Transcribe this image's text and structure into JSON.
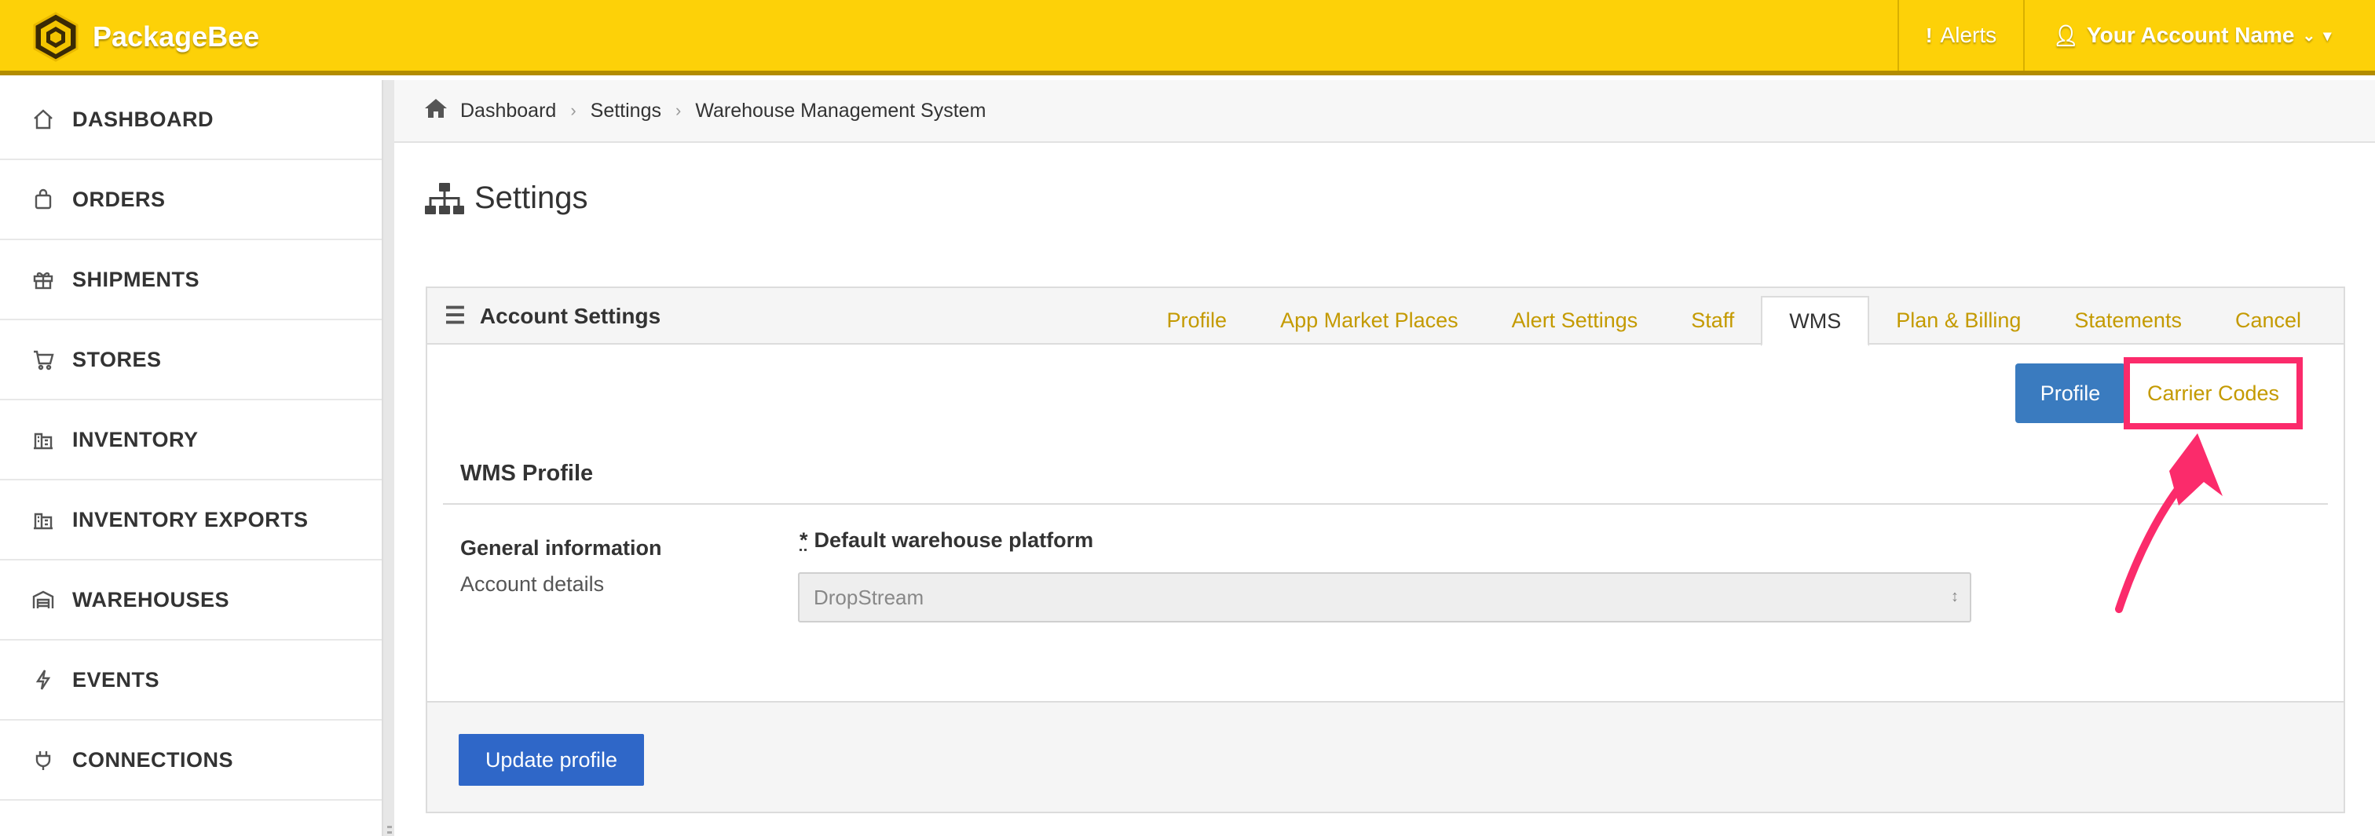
{
  "app": {
    "name": "PackageBee"
  },
  "topnav": {
    "alerts_label": "Alerts",
    "account_label": "Your Account Name"
  },
  "sidebar": {
    "items": [
      {
        "label": "DASHBOARD",
        "icon": "home-icon"
      },
      {
        "label": "ORDERS",
        "icon": "bag-icon"
      },
      {
        "label": "SHIPMENTS",
        "icon": "gift-icon"
      },
      {
        "label": "STORES",
        "icon": "cart-icon"
      },
      {
        "label": "INVENTORY",
        "icon": "building-icon"
      },
      {
        "label": "INVENTORY EXPORTS",
        "icon": "building-icon"
      },
      {
        "label": "WAREHOUSES",
        "icon": "warehouse-icon"
      },
      {
        "label": "EVENTS",
        "icon": "bolt-icon"
      },
      {
        "label": "CONNECTIONS",
        "icon": "plug-icon"
      }
    ]
  },
  "breadcrumb": {
    "items": [
      "Dashboard",
      "Settings",
      "Warehouse Management System"
    ]
  },
  "page": {
    "title": "Settings"
  },
  "card": {
    "title": "Account Settings",
    "tabs": [
      {
        "label": "Profile",
        "active": false
      },
      {
        "label": "App Market Places",
        "active": false
      },
      {
        "label": "Alert Settings",
        "active": false
      },
      {
        "label": "Staff",
        "active": false
      },
      {
        "label": "WMS",
        "active": true
      },
      {
        "label": "Plan & Billing",
        "active": false
      },
      {
        "label": "Statements",
        "active": false
      },
      {
        "label": "Cancel",
        "active": false
      }
    ],
    "subnav": {
      "profile_label": "Profile",
      "carrier_codes_label": "Carrier Codes"
    },
    "section_title": "WMS Profile",
    "general_info": {
      "label": "General information",
      "sub": "Account details"
    },
    "field": {
      "required_mark": "*",
      "label": "Default warehouse platform",
      "value": "DropStream"
    },
    "footer": {
      "update_label": "Update profile"
    }
  },
  "colors": {
    "brand": "#fdd108",
    "link": "#c49a00",
    "primary": "#3a7bbf",
    "highlight": "#fb2b6b"
  }
}
